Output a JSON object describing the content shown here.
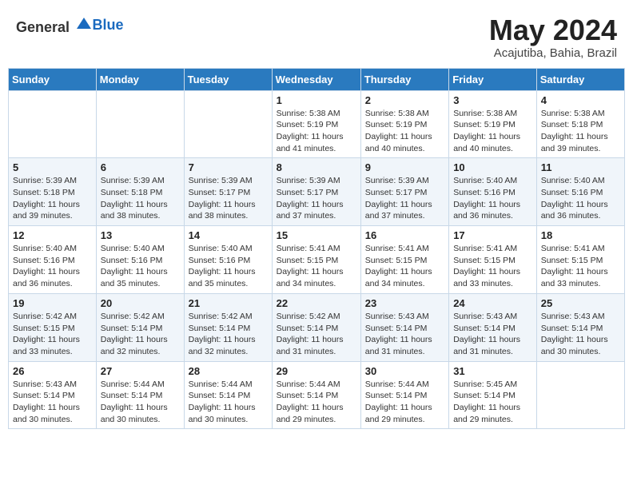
{
  "header": {
    "logo_general": "General",
    "logo_blue": "Blue",
    "title": "May 2024",
    "subtitle": "Acajutiba, Bahia, Brazil"
  },
  "days_of_week": [
    "Sunday",
    "Monday",
    "Tuesday",
    "Wednesday",
    "Thursday",
    "Friday",
    "Saturday"
  ],
  "weeks": [
    [
      {
        "day": "",
        "info": ""
      },
      {
        "day": "",
        "info": ""
      },
      {
        "day": "",
        "info": ""
      },
      {
        "day": "1",
        "sunrise": "5:38 AM",
        "sunset": "5:19 PM",
        "daylight": "11 hours and 41 minutes."
      },
      {
        "day": "2",
        "sunrise": "5:38 AM",
        "sunset": "5:19 PM",
        "daylight": "11 hours and 40 minutes."
      },
      {
        "day": "3",
        "sunrise": "5:38 AM",
        "sunset": "5:19 PM",
        "daylight": "11 hours and 40 minutes."
      },
      {
        "day": "4",
        "sunrise": "5:38 AM",
        "sunset": "5:18 PM",
        "daylight": "11 hours and 39 minutes."
      }
    ],
    [
      {
        "day": "5",
        "sunrise": "5:39 AM",
        "sunset": "5:18 PM",
        "daylight": "11 hours and 39 minutes."
      },
      {
        "day": "6",
        "sunrise": "5:39 AM",
        "sunset": "5:18 PM",
        "daylight": "11 hours and 38 minutes."
      },
      {
        "day": "7",
        "sunrise": "5:39 AM",
        "sunset": "5:17 PM",
        "daylight": "11 hours and 38 minutes."
      },
      {
        "day": "8",
        "sunrise": "5:39 AM",
        "sunset": "5:17 PM",
        "daylight": "11 hours and 37 minutes."
      },
      {
        "day": "9",
        "sunrise": "5:39 AM",
        "sunset": "5:17 PM",
        "daylight": "11 hours and 37 minutes."
      },
      {
        "day": "10",
        "sunrise": "5:40 AM",
        "sunset": "5:16 PM",
        "daylight": "11 hours and 36 minutes."
      },
      {
        "day": "11",
        "sunrise": "5:40 AM",
        "sunset": "5:16 PM",
        "daylight": "11 hours and 36 minutes."
      }
    ],
    [
      {
        "day": "12",
        "sunrise": "5:40 AM",
        "sunset": "5:16 PM",
        "daylight": "11 hours and 36 minutes."
      },
      {
        "day": "13",
        "sunrise": "5:40 AM",
        "sunset": "5:16 PM",
        "daylight": "11 hours and 35 minutes."
      },
      {
        "day": "14",
        "sunrise": "5:40 AM",
        "sunset": "5:16 PM",
        "daylight": "11 hours and 35 minutes."
      },
      {
        "day": "15",
        "sunrise": "5:41 AM",
        "sunset": "5:15 PM",
        "daylight": "11 hours and 34 minutes."
      },
      {
        "day": "16",
        "sunrise": "5:41 AM",
        "sunset": "5:15 PM",
        "daylight": "11 hours and 34 minutes."
      },
      {
        "day": "17",
        "sunrise": "5:41 AM",
        "sunset": "5:15 PM",
        "daylight": "11 hours and 33 minutes."
      },
      {
        "day": "18",
        "sunrise": "5:41 AM",
        "sunset": "5:15 PM",
        "daylight": "11 hours and 33 minutes."
      }
    ],
    [
      {
        "day": "19",
        "sunrise": "5:42 AM",
        "sunset": "5:15 PM",
        "daylight": "11 hours and 33 minutes."
      },
      {
        "day": "20",
        "sunrise": "5:42 AM",
        "sunset": "5:14 PM",
        "daylight": "11 hours and 32 minutes."
      },
      {
        "day": "21",
        "sunrise": "5:42 AM",
        "sunset": "5:14 PM",
        "daylight": "11 hours and 32 minutes."
      },
      {
        "day": "22",
        "sunrise": "5:42 AM",
        "sunset": "5:14 PM",
        "daylight": "11 hours and 31 minutes."
      },
      {
        "day": "23",
        "sunrise": "5:43 AM",
        "sunset": "5:14 PM",
        "daylight": "11 hours and 31 minutes."
      },
      {
        "day": "24",
        "sunrise": "5:43 AM",
        "sunset": "5:14 PM",
        "daylight": "11 hours and 31 minutes."
      },
      {
        "day": "25",
        "sunrise": "5:43 AM",
        "sunset": "5:14 PM",
        "daylight": "11 hours and 30 minutes."
      }
    ],
    [
      {
        "day": "26",
        "sunrise": "5:43 AM",
        "sunset": "5:14 PM",
        "daylight": "11 hours and 30 minutes."
      },
      {
        "day": "27",
        "sunrise": "5:44 AM",
        "sunset": "5:14 PM",
        "daylight": "11 hours and 30 minutes."
      },
      {
        "day": "28",
        "sunrise": "5:44 AM",
        "sunset": "5:14 PM",
        "daylight": "11 hours and 30 minutes."
      },
      {
        "day": "29",
        "sunrise": "5:44 AM",
        "sunset": "5:14 PM",
        "daylight": "11 hours and 29 minutes."
      },
      {
        "day": "30",
        "sunrise": "5:44 AM",
        "sunset": "5:14 PM",
        "daylight": "11 hours and 29 minutes."
      },
      {
        "day": "31",
        "sunrise": "5:45 AM",
        "sunset": "5:14 PM",
        "daylight": "11 hours and 29 minutes."
      },
      {
        "day": "",
        "info": ""
      }
    ]
  ],
  "labels": {
    "sunrise": "Sunrise:",
    "sunset": "Sunset:",
    "daylight": "Daylight:"
  }
}
